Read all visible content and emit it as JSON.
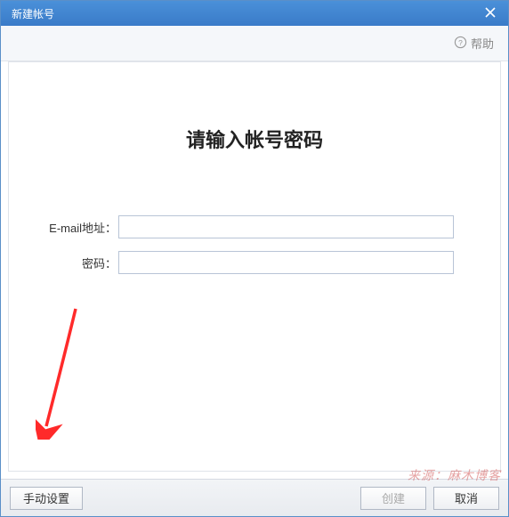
{
  "titlebar": {
    "title": "新建帐号"
  },
  "toolbar": {
    "help_label": "帮助"
  },
  "main": {
    "heading": "请输入帐号密码",
    "email_label": "E-mail地址：",
    "email_value": "",
    "password_label": "密码：",
    "password_value": ""
  },
  "footer": {
    "manual_label": "手动设置",
    "create_label": "创建",
    "cancel_label": "取消"
  },
  "watermark": "来源：麻木博客"
}
